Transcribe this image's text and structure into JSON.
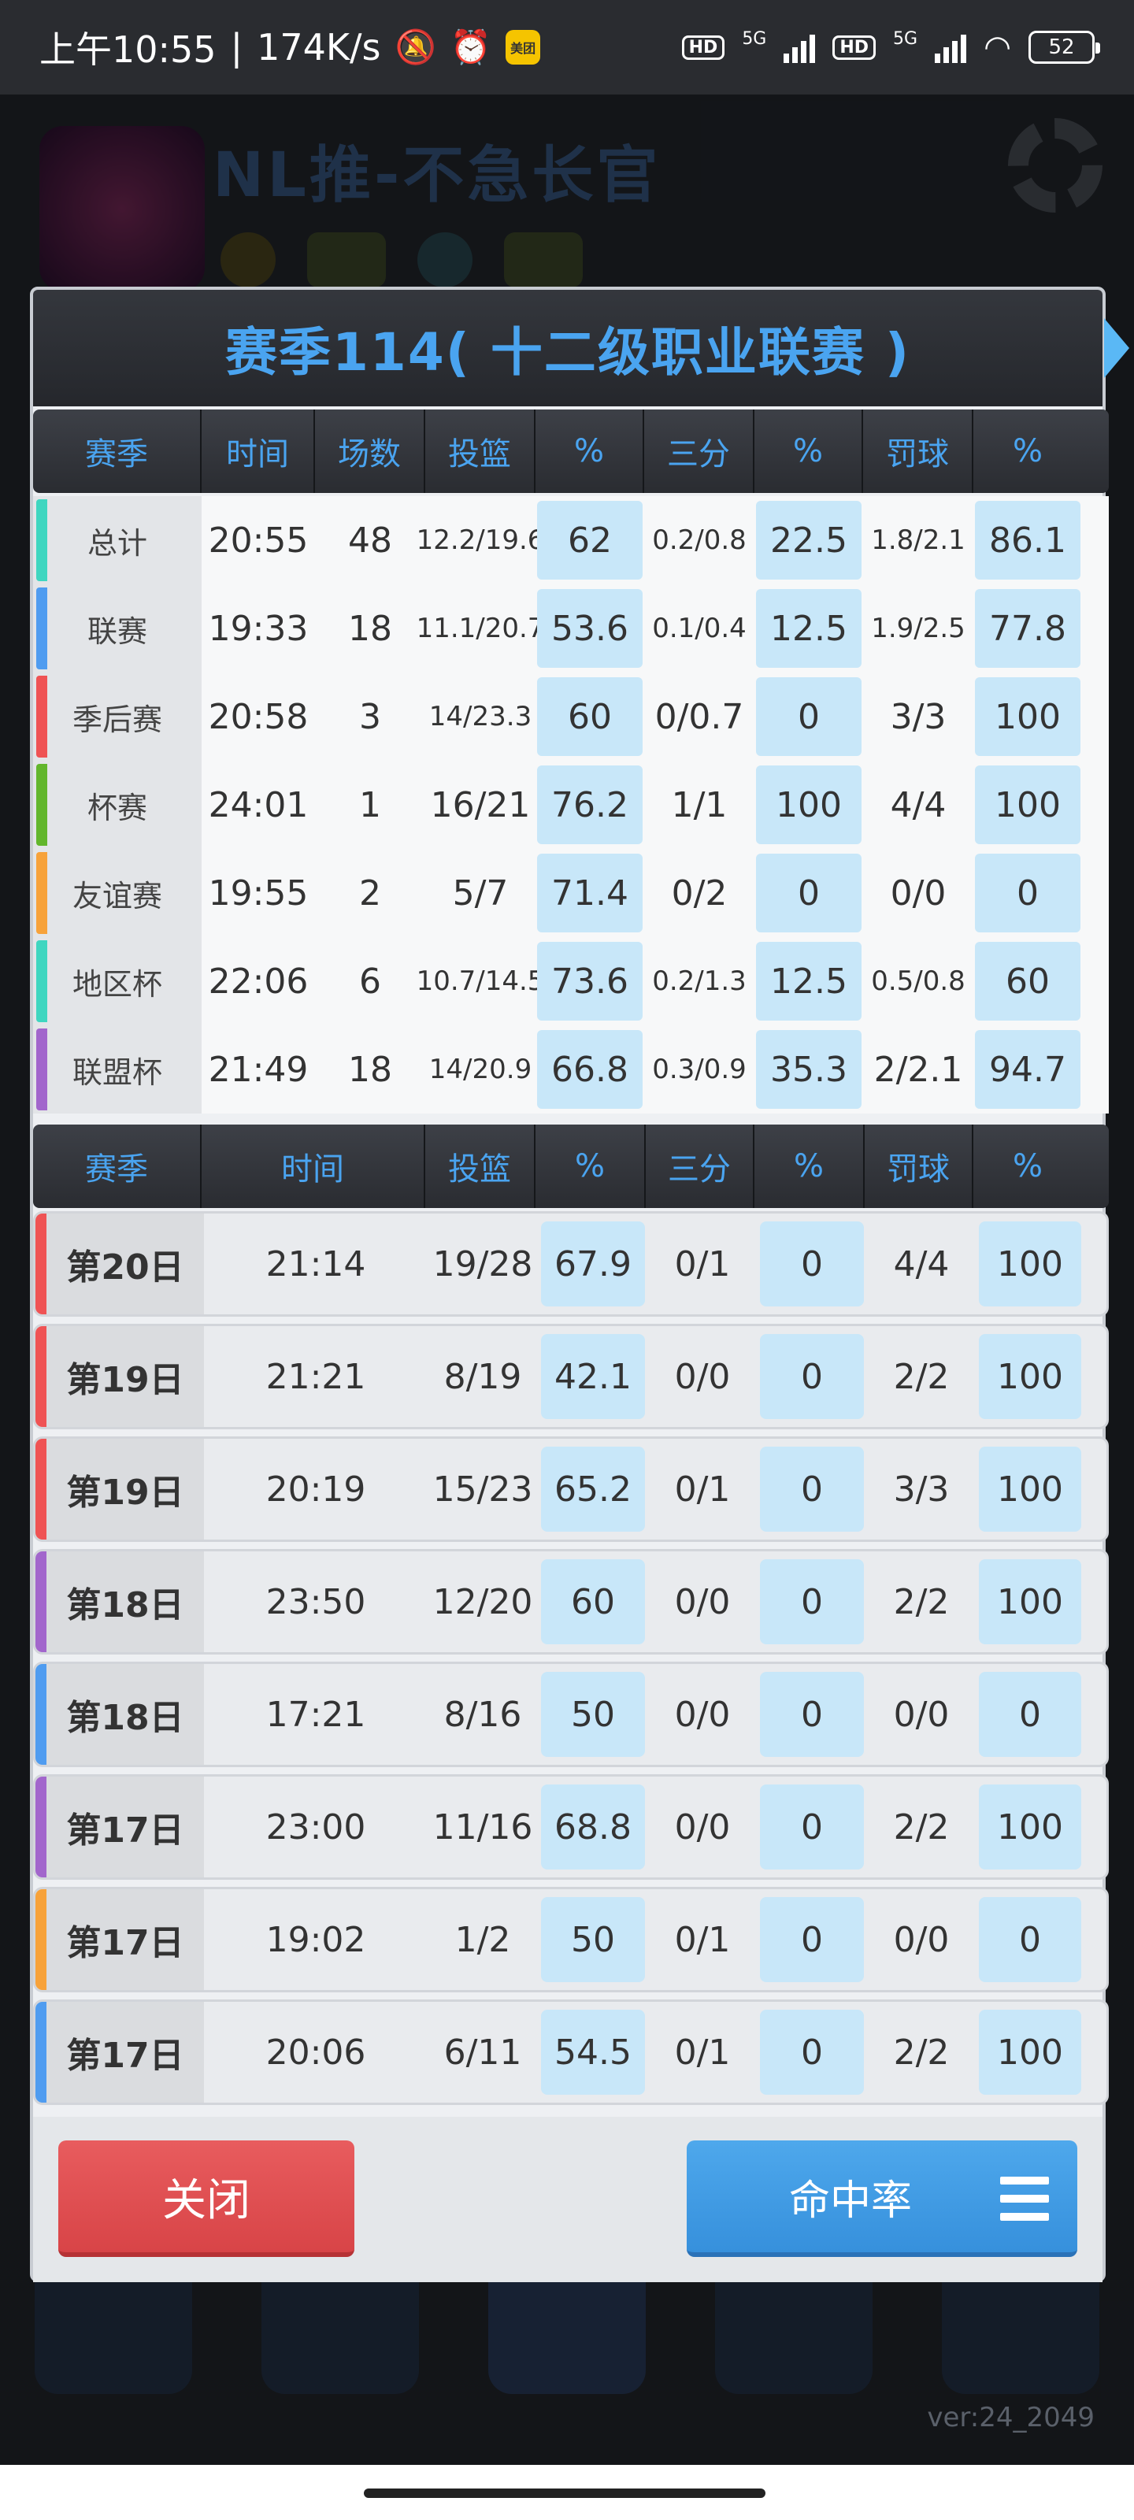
{
  "status_bar": {
    "time": "上午10:55",
    "speed": "174K/s",
    "battery": "52",
    "hd1": "HD",
    "hd2": "HD",
    "net1": "5G",
    "net2": "5G",
    "app_badge": "美团"
  },
  "background": {
    "title": "NL推-不急长官",
    "version": "ver:24_2049"
  },
  "dialog": {
    "title": "赛季114( 十二级职业联赛 )"
  },
  "summary_table": {
    "headers": [
      "赛季",
      "时间",
      "场数",
      "投篮",
      "%",
      "三分",
      "%",
      "罚球",
      "%"
    ],
    "rows": [
      {
        "name": "总计",
        "time": "20:55",
        "games": "48",
        "fg": "12.2/19.6",
        "fg_pct": "62",
        "three": "0.2/0.8",
        "three_pct": "22.5",
        "ft": "1.8/2.1",
        "ft_pct": "86.1",
        "color": "#3fd6c0"
      },
      {
        "name": "联赛",
        "time": "19:33",
        "games": "18",
        "fg": "11.1/20.7",
        "fg_pct": "53.6",
        "three": "0.1/0.4",
        "three_pct": "12.5",
        "ft": "1.9/2.5",
        "ft_pct": "77.8",
        "color": "#4f9cf0"
      },
      {
        "name": "季后赛",
        "time": "20:58",
        "games": "3",
        "fg": "14/23.3",
        "fg_pct": "60",
        "three": "0/0.7",
        "three_pct": "0",
        "ft": "3/3",
        "ft_pct": "100",
        "color": "#ef5354"
      },
      {
        "name": "杯赛",
        "time": "24:01",
        "games": "1",
        "fg": "16/21",
        "fg_pct": "76.2",
        "three": "1/1",
        "three_pct": "100",
        "ft": "4/4",
        "ft_pct": "100",
        "color": "#62b62c"
      },
      {
        "name": "友谊赛",
        "time": "19:55",
        "games": "2",
        "fg": "5/7",
        "fg_pct": "71.4",
        "three": "0/2",
        "three_pct": "0",
        "ft": "0/0",
        "ft_pct": "0",
        "color": "#f7a23a"
      },
      {
        "name": "地区杯",
        "time": "22:06",
        "games": "6",
        "fg": "10.7/14.5",
        "fg_pct": "73.6",
        "three": "0.2/1.3",
        "three_pct": "12.5",
        "ft": "0.5/0.8",
        "ft_pct": "60",
        "color": "#3fd6c0"
      },
      {
        "name": "联盟杯",
        "time": "21:49",
        "games": "18",
        "fg": "14/20.9",
        "fg_pct": "66.8",
        "three": "0.3/0.9",
        "three_pct": "35.3",
        "ft": "2/2.1",
        "ft_pct": "94.7",
        "color": "#a266cc"
      }
    ]
  },
  "games_table": {
    "headers": [
      "赛季",
      "时间",
      "投篮",
      "%",
      "三分",
      "%",
      "罚球",
      "%"
    ],
    "rows": [
      {
        "name": "第20日",
        "time": "21:14",
        "fg": "19/28",
        "fg_pct": "67.9",
        "three": "0/1",
        "three_pct": "0",
        "ft": "4/4",
        "ft_pct": "100",
        "color": "#ef5354"
      },
      {
        "name": "第19日",
        "time": "21:21",
        "fg": "8/19",
        "fg_pct": "42.1",
        "three": "0/0",
        "three_pct": "0",
        "ft": "2/2",
        "ft_pct": "100",
        "color": "#ef5354"
      },
      {
        "name": "第19日",
        "time": "20:19",
        "fg": "15/23",
        "fg_pct": "65.2",
        "three": "0/1",
        "three_pct": "0",
        "ft": "3/3",
        "ft_pct": "100",
        "color": "#ef5354"
      },
      {
        "name": "第18日",
        "time": "23:50",
        "fg": "12/20",
        "fg_pct": "60",
        "three": "0/0",
        "three_pct": "0",
        "ft": "2/2",
        "ft_pct": "100",
        "color": "#a266cc"
      },
      {
        "name": "第18日",
        "time": "17:21",
        "fg": "8/16",
        "fg_pct": "50",
        "three": "0/0",
        "three_pct": "0",
        "ft": "0/0",
        "ft_pct": "0",
        "color": "#4f9cf0"
      },
      {
        "name": "第17日",
        "time": "23:00",
        "fg": "11/16",
        "fg_pct": "68.8",
        "three": "0/0",
        "three_pct": "0",
        "ft": "2/2",
        "ft_pct": "100",
        "color": "#a266cc"
      },
      {
        "name": "第17日",
        "time": "19:02",
        "fg": "1/2",
        "fg_pct": "50",
        "three": "0/1",
        "three_pct": "0",
        "ft": "0/0",
        "ft_pct": "0",
        "color": "#f7a23a"
      },
      {
        "name": "第17日",
        "time": "20:06",
        "fg": "6/11",
        "fg_pct": "54.5",
        "three": "0/1",
        "three_pct": "0",
        "ft": "2/2",
        "ft_pct": "100",
        "color": "#4f9cf0"
      }
    ]
  },
  "footer": {
    "close_label": "关闭",
    "rate_label": "命中率"
  }
}
